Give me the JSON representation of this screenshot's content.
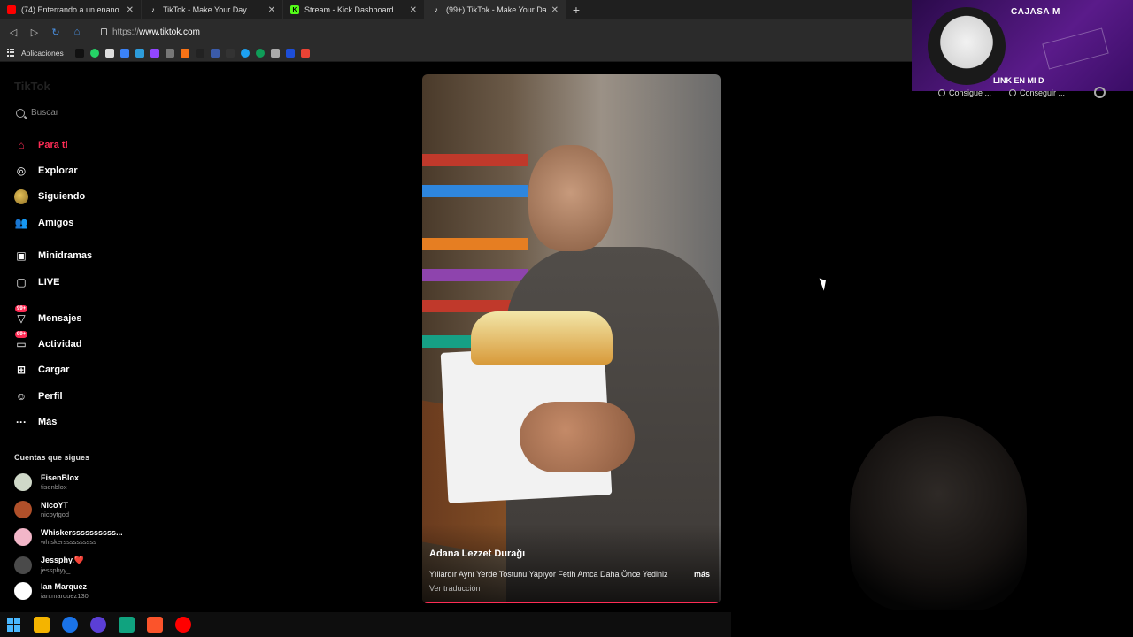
{
  "browser": {
    "tabs": [
      {
        "label": "(74) Enterrando a un enano (BR",
        "favicon_color": "#ff0000",
        "active": false
      },
      {
        "label": "TikTok - Make Your Day",
        "favicon_color": "#ffffff",
        "active": false
      },
      {
        "label": "Stream - Kick Dashboard",
        "favicon_color": "#53fc18",
        "active": false
      },
      {
        "label": "(99+) TikTok - Make Your Da",
        "favicon_color": "#ffffff",
        "active": true
      }
    ],
    "url_protocol": "https://",
    "url_host": "www.tiktok.com",
    "bookmarks_apps_label": "Aplicaciones"
  },
  "tiktok": {
    "logo_text": "TikTok",
    "search_placeholder": "Buscar",
    "nav": [
      {
        "label": "Para ti",
        "icon": "home-icon",
        "active": true
      },
      {
        "label": "Explorar",
        "icon": "compass-icon"
      },
      {
        "label": "Siguiendo",
        "icon": "avatar-icon"
      },
      {
        "label": "Amigos",
        "icon": "friends-icon"
      },
      {
        "label": "Minidramas",
        "icon": "film-icon"
      },
      {
        "label": "LIVE",
        "icon": "live-icon"
      },
      {
        "label": "Mensajes",
        "icon": "messages-icon",
        "badge": "99+"
      },
      {
        "label": "Actividad",
        "icon": "activity-icon",
        "badge": "99+"
      },
      {
        "label": "Cargar",
        "icon": "upload-icon"
      },
      {
        "label": "Perfil",
        "icon": "profile-icon"
      },
      {
        "label": "Más",
        "icon": "more-icon"
      }
    ],
    "following_title": "Cuentas que sigues",
    "following": [
      {
        "name": "FisenBlox",
        "username": "fisenblox",
        "color": "#cfd8c8"
      },
      {
        "name": "NicoYT",
        "username": "nicoytgod",
        "color": "#b0502a"
      },
      {
        "name": "Whiskerssssssssss...",
        "username": "whiskerssssssssss",
        "color": "#f2b6c8"
      },
      {
        "name": "Jessphy.❤️",
        "username": "jessphyy_",
        "color": "#4a4a4a"
      },
      {
        "name": "lan Marquez",
        "username": "ian.marquez130",
        "color": "#ffffff"
      }
    ],
    "video": {
      "author": "Adana Lezzet Durağı",
      "caption": "Yıllardır Aynı Yerde Tostunu Yapıyor Fetih Amca Daha Önce Yediniz",
      "more_label": "más",
      "translate_label": "Ver traducción",
      "progress": 1.0
    }
  },
  "overlay": {
    "top_text": "CAJASA M",
    "bottom_text": "LINK EN MI D",
    "ext_items": [
      "Consigue ...",
      "Conseguir ..."
    ]
  },
  "colors": {
    "accent": "#fe2c55"
  }
}
